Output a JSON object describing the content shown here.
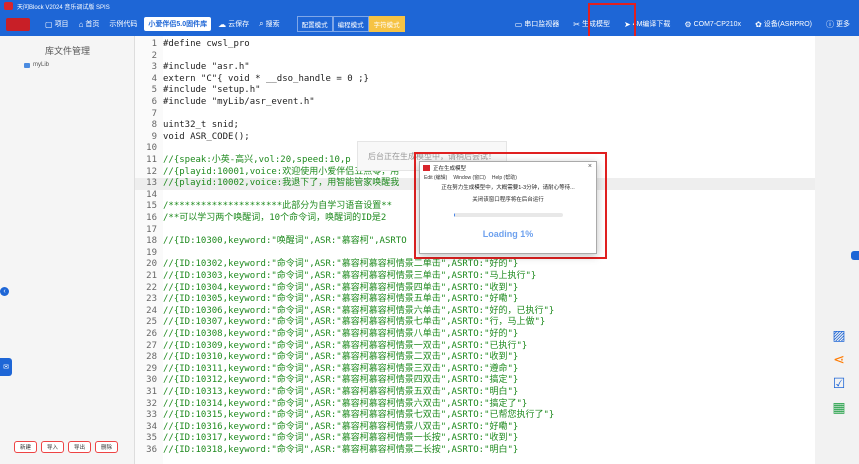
{
  "window": {
    "title": "天问Block V2024 音乐调试版 SPIS"
  },
  "toolbar": {
    "left_items": [
      {
        "icon": "folder-icon",
        "label": "项目"
      },
      {
        "icon": "home-icon",
        "label": "首页"
      },
      {
        "icon": "",
        "label": "示例代码"
      }
    ],
    "project_tab": "小爱伴侣5.0固件库",
    "save_label": "云保存",
    "search_label": "搜索",
    "modes": [
      "配置模式",
      "编程模式",
      "字符模式"
    ],
    "right_items": [
      {
        "icon": "monitor-icon",
        "label": "串口监视器"
      },
      {
        "icon": "tools-icon",
        "label": "生成模型"
      },
      {
        "icon": "download-icon",
        "label": "4M编译下载"
      },
      {
        "icon": "usb-icon",
        "label": "COM7-CP210x"
      },
      {
        "icon": "gear-icon",
        "label": "设备(ASRPRO)"
      },
      {
        "icon": "info-icon",
        "label": "更多"
      }
    ]
  },
  "sidebar": {
    "title": "库文件管理",
    "items": [
      {
        "label": "myLib"
      }
    ],
    "buttons": [
      "新建",
      "导入",
      "导出",
      "删除"
    ]
  },
  "editor": {
    "lines": [
      {
        "n": "1",
        "text": "#define cwsl_pro"
      },
      {
        "n": "2",
        "text": ""
      },
      {
        "n": "3",
        "text": "#include \"asr.h\""
      },
      {
        "n": "4",
        "text": "extern \"C\"{ void * __dso_handle = 0 ;}"
      },
      {
        "n": "5",
        "text": "#include \"setup.h\""
      },
      {
        "n": "6",
        "text": "#include \"myLib/asr_event.h\""
      },
      {
        "n": "7",
        "text": ""
      },
      {
        "n": "8",
        "text": "uint32_t snid;"
      },
      {
        "n": "9",
        "text": "void ASR_CODE();"
      },
      {
        "n": "10",
        "text": ""
      },
      {
        "n": "11",
        "text": "//{speak:小英-高兴,vol:20,speed:10,p                    3}"
      },
      {
        "n": "12",
        "text": "//{playid:10001,voice:欢迎使用小爱伴侣五点零，用"
      },
      {
        "n": "13",
        "text": "//{playid:10002,voice:我退下了，用智能管家唤醒我"
      },
      {
        "n": "14",
        "text": ""
      },
      {
        "n": "15",
        "text": "/*********************此部分为自学习语音设置**"
      },
      {
        "n": "16",
        "text": "/**可以学习两个唤醒词，10个命令词，唤醒词的ID是2"
      },
      {
        "n": "17",
        "text": ""
      },
      {
        "n": "18",
        "text": "//{ID:10300,keyword:\"唤醒词\",ASR:\"慕容柯\",ASRTO"
      },
      {
        "n": "19",
        "text": ""
      },
      {
        "n": "20",
        "text": "//{ID:10302,keyword:\"命令词\",ASR:\"慕容柯慕容柯情景二单击\",ASRTO:\"好的\"}"
      },
      {
        "n": "21",
        "text": "//{ID:10303,keyword:\"命令词\",ASR:\"慕容柯慕容柯情景三单击\",ASRTO:\"马上执行\"}"
      },
      {
        "n": "22",
        "text": "//{ID:10304,keyword:\"命令词\",ASR:\"慕容柯慕容柯情景四单击\",ASRTO:\"收到\"}"
      },
      {
        "n": "23",
        "text": "//{ID:10305,keyword:\"命令词\",ASR:\"慕容柯慕容柯情景五单击\",ASRTO:\"好嘞\"}"
      },
      {
        "n": "24",
        "text": "//{ID:10306,keyword:\"命令词\",ASR:\"慕容柯慕容柯情景六单击\",ASRTO:\"好的，已执行\"}"
      },
      {
        "n": "25",
        "text": "//{ID:10307,keyword:\"命令词\",ASR:\"慕容柯慕容柯情景七单击\",ASRTO:\"行，马上做\"}"
      },
      {
        "n": "26",
        "text": "//{ID:10308,keyword:\"命令词\",ASR:\"慕容柯慕容柯情景八单击\",ASRTO:\"好的\"}"
      },
      {
        "n": "27",
        "text": "//{ID:10309,keyword:\"命令词\",ASR:\"慕容柯慕容柯情景一双击\",ASRTO:\"已执行\"}"
      },
      {
        "n": "28",
        "text": "//{ID:10310,keyword:\"命令词\",ASR:\"慕容柯慕容柯情景二双击\",ASRTO:\"收到\"}"
      },
      {
        "n": "29",
        "text": "//{ID:10311,keyword:\"命令词\",ASR:\"慕容柯慕容柯情景三双击\",ASRTO:\"遵命\"}"
      },
      {
        "n": "30",
        "text": "//{ID:10312,keyword:\"命令词\",ASR:\"慕容柯慕容柯情景四双击\",ASRTO:\"搞定\"}"
      },
      {
        "n": "31",
        "text": "//{ID:10313,keyword:\"命令词\",ASR:\"慕容柯慕容柯情景五双击\",ASRTO:\"明白\"}"
      },
      {
        "n": "32",
        "text": "//{ID:10314,keyword:\"命令词\",ASR:\"慕容柯慕容柯情景六双击\",ASRTO:\"搞定了\"}"
      },
      {
        "n": "33",
        "text": "//{ID:10315,keyword:\"命令词\",ASR:\"慕容柯慕容柯情景七双击\",ASRTO:\"已帮您执行了\"}"
      },
      {
        "n": "34",
        "text": "//{ID:10316,keyword:\"命令词\",ASR:\"慕容柯慕容柯情景八双击\",ASRTO:\"好嘞\"}"
      },
      {
        "n": "35",
        "text": "//{ID:10317,keyword:\"命令词\",ASR:\"慕容柯慕容柯情景一长按\",ASRTO:\"收到\"}"
      },
      {
        "n": "36",
        "text": "//{ID:10318,keyword:\"命令词\",ASR:\"慕容柯慕容柯情景二长按\",ASRTO:\"明白\"}"
      }
    ]
  },
  "toast": {
    "text": "后台正在生成模型中，请稍后尝试！"
  },
  "modal": {
    "title": "正在生成模型",
    "close": "×",
    "menu": [
      "Edit (编辑)",
      "Window (窗口)",
      "Help (帮助)"
    ],
    "message_1": "正在努力生成模型中，大概需要1-3分钟，请耐心等待...",
    "message_2": "关闭该窗口程序将在后台运行",
    "progress_percent": 1,
    "loading_text": "Loading 1%"
  }
}
